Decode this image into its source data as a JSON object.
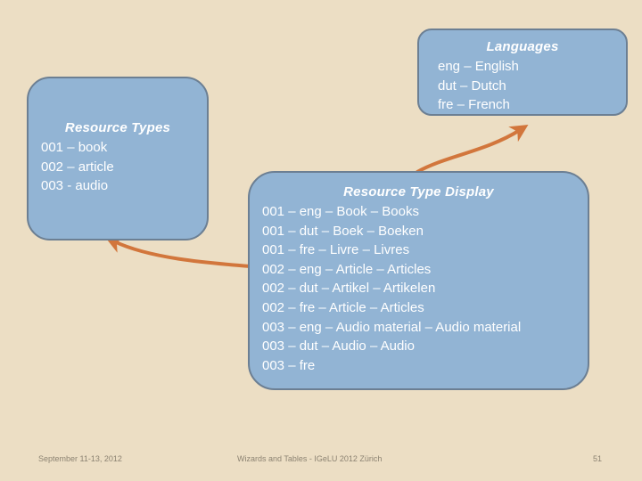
{
  "slide": {
    "background_color": "#ecdec4",
    "box_fill_color": "#92b4d4",
    "box_border_color": "#6c7f93",
    "arrow_color": "#d2763c",
    "text_color": "#ffffff",
    "footer_text_color": "#8c8372"
  },
  "languages_box": {
    "title": "Languages",
    "lines": [
      "eng – English",
      "dut – Dutch",
      "fre – French"
    ]
  },
  "resource_types_box": {
    "title": "Resource Types",
    "lines": [
      "001 – book",
      "002 – article",
      "003 - audio"
    ]
  },
  "resource_type_display_box": {
    "title": "Resource Type Display",
    "lines": [
      "001 – eng – Book – Books",
      "001 – dut – Boek – Boeken",
      "001 – fre – Livre – Livres",
      "002 – eng – Article – Articles",
      "002 – dut – Artikel – Artikelen",
      "002 – fre – Article – Articles",
      "003 – eng – Audio material – Audio material",
      "003 – dut – Audio – Audio",
      "003 – fre"
    ]
  },
  "connectors": [
    {
      "name": "display-to-languages",
      "from": "resource-type-display-box",
      "to": "languages-box"
    },
    {
      "name": "display-to-resource-types",
      "from": "resource-type-display-box",
      "to": "resource-types-box"
    }
  ],
  "footer": {
    "date": "September 11-13, 2012",
    "center": "Wizards and Tables - IGeLU 2012 Zürich",
    "page_number": "51"
  }
}
